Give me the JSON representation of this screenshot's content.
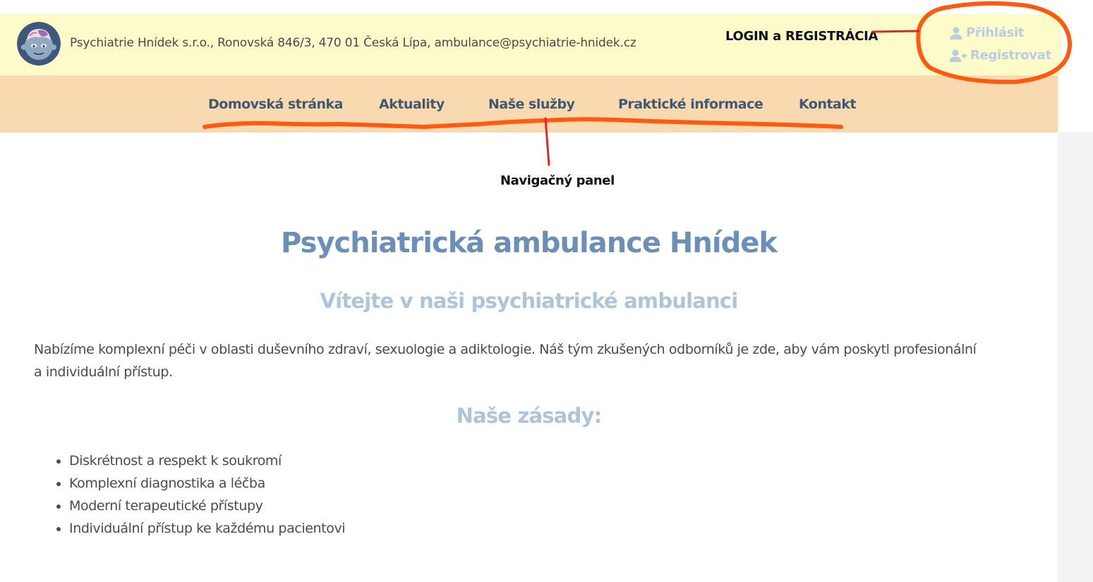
{
  "header": {
    "contact_line": "Psychiatrie Hnídek s.r.o., Ronovská 846/3, 470 01 Česká Lípa, ambulance@psychiatrie-hnidek.cz",
    "logo_icon": "brain-character-icon",
    "login_label": "Přihlásit",
    "register_label": "Registrovat",
    "login_icon": "user-icon",
    "register_icon": "user-plus-icon"
  },
  "annotations": {
    "login_registration": "LOGIN a REGISTRÁCIA",
    "nav_panel": "Navigačný panel",
    "highlight_color": "#ff5a10",
    "arrow_color": "#e0282a"
  },
  "nav": {
    "items": [
      {
        "label": "Domovská stránka"
      },
      {
        "label": "Aktuality"
      },
      {
        "label": "Naše služby"
      },
      {
        "label": "Praktické informace"
      },
      {
        "label": "Kontakt"
      }
    ]
  },
  "main": {
    "title": "Psychiatrická ambulance Hnídek",
    "subtitle": "Vítejte v naši psychiatrické ambulanci",
    "intro": "Nabízíme komplexní péči v oblasti duševního zdraví, sexuologie a adiktologie. Náš tým zkušených odborníků je zde, aby vám poskytl profesionální a individuální přístup.",
    "principles_title": "Naše zásady:",
    "principles": [
      "Diskrétnost a respekt k soukromí",
      "Komplexní diagnostika a léčba",
      "Moderní terapeutické přístupy",
      "Individuální přístup ke každému pacientovi"
    ]
  },
  "colors": {
    "topbar_bg": "#fefbcb",
    "navbar_bg": "#f9dab0",
    "nav_text": "#3f5873",
    "title": "#6b8fb7",
    "subtitle": "#aec5d8",
    "auth_link": "#b9cde0"
  }
}
